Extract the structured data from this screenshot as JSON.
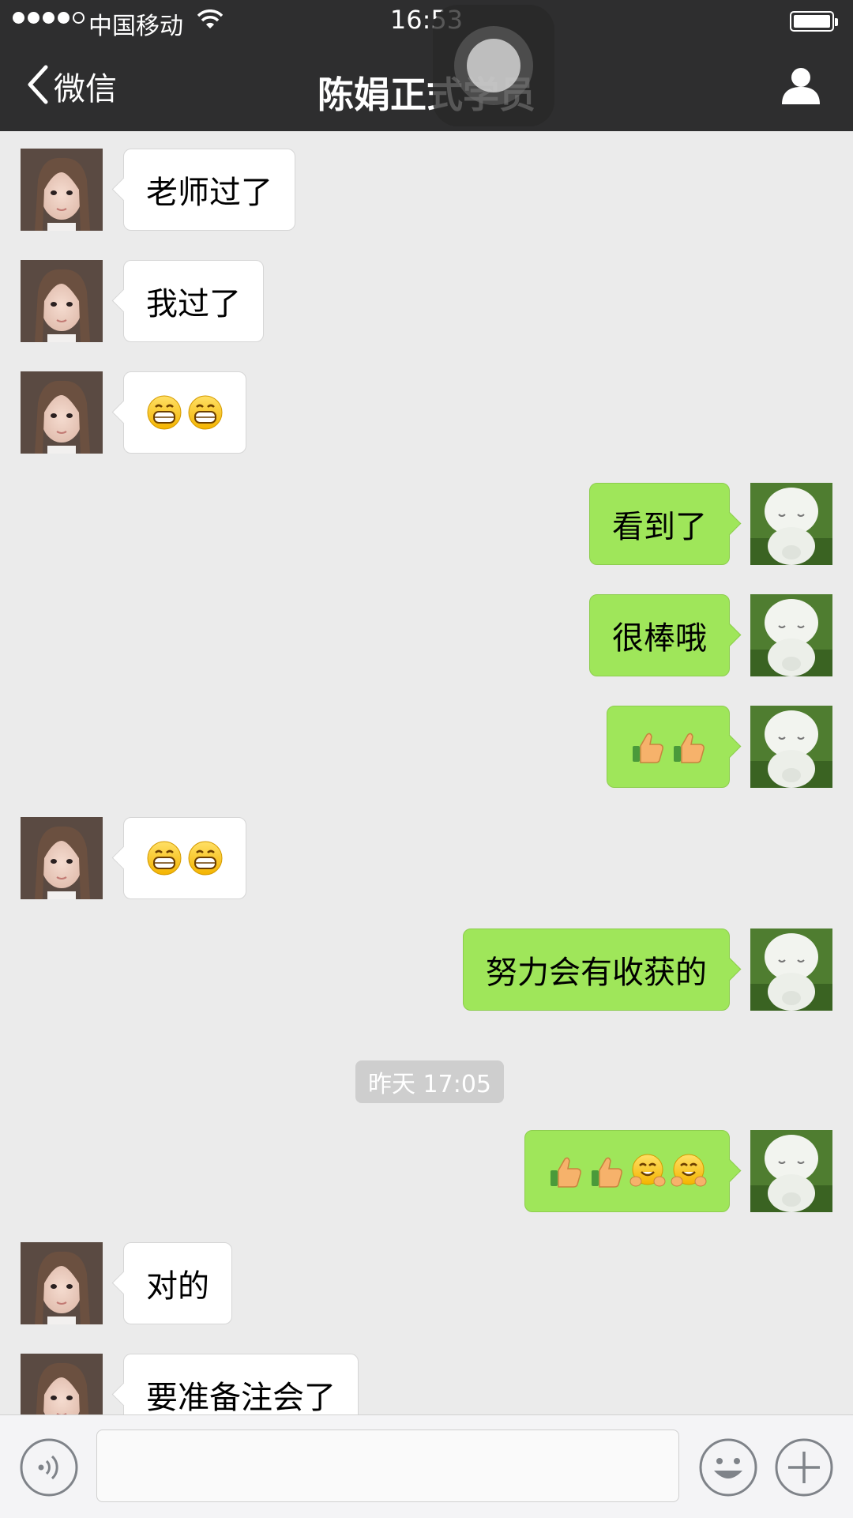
{
  "status_bar": {
    "carrier": "中国移动",
    "time": "16:53"
  },
  "nav": {
    "back_label": "微信",
    "title": "陈娟正式学员"
  },
  "timestamp": "昨天 17:05",
  "messages": [
    {
      "side": "in",
      "text": "老师过了"
    },
    {
      "side": "in",
      "text": "我过了"
    },
    {
      "side": "in",
      "emojis": [
        "grin-emoji",
        "grin-emoji"
      ]
    },
    {
      "side": "out",
      "text": "看到了"
    },
    {
      "side": "out",
      "text": "很棒哦"
    },
    {
      "side": "out",
      "emojis": [
        "thumbs-up-emoji",
        "thumbs-up-emoji"
      ]
    },
    {
      "side": "in",
      "emojis": [
        "grin-emoji",
        "grin-emoji"
      ]
    },
    {
      "side": "out",
      "text": "努力会有收获的"
    },
    {
      "side": "out",
      "emojis": [
        "thumbs-up-emoji",
        "thumbs-up-emoji",
        "hug-emoji",
        "hug-emoji"
      ]
    },
    {
      "side": "in",
      "text": "对的"
    },
    {
      "side": "in",
      "text": "要准备注会了"
    }
  ],
  "input": {
    "value": ""
  },
  "icons": {
    "voice": "voice-icon",
    "emoji": "smiley-icon",
    "more": "plus-icon",
    "contact": "person-icon",
    "back": "chevron-left-icon"
  },
  "colors": {
    "nav_bg": "#2e2e2f",
    "chat_bg": "#ebebeb",
    "outgoing_bubble": "#9fe65a",
    "incoming_bubble": "#ffffff"
  }
}
